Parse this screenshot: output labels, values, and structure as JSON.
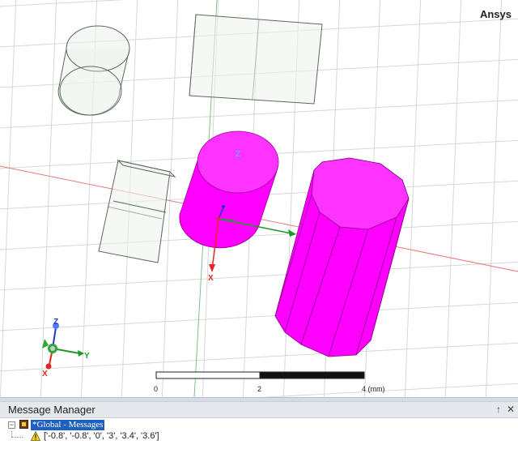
{
  "viewport": {
    "brand": "Ansys",
    "model_axes": {
      "z": "Z",
      "x": "X"
    },
    "triad": {
      "z": "Z",
      "x": "X",
      "y": "Y"
    },
    "scale_bar": {
      "labels": [
        "0",
        "2",
        "4 (mm)"
      ]
    },
    "colors": {
      "solid": "#ff00ff",
      "wireframe": "#5a6a5a",
      "grid": "#d2d6d6",
      "axis_red": "#e2281e",
      "axis_green": "#1b9a2a",
      "axis_blue": "#2233cc"
    }
  },
  "message_manager": {
    "title": "Message Manager",
    "pin_icon": "pin-icon",
    "close_icon": "close-icon",
    "tree": {
      "root_label": "*Global - Messages",
      "messages": [
        {
          "icon": "warning-icon",
          "text": "['-0.8', '-0.8', '0', '3', '3.4', '3.6']"
        }
      ]
    }
  }
}
